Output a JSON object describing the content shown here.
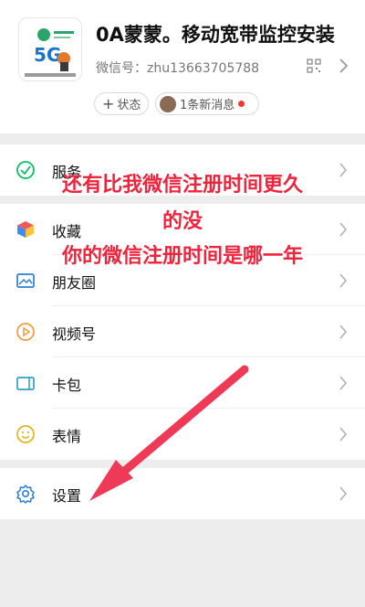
{
  "profile": {
    "nickname": "0A蒙蒙。移动宽带监控安装",
    "wechat_id": "微信号：zhu13663705788",
    "status_chip": "状态",
    "msg_chip": "1条新消息"
  },
  "menu": {
    "services": "服务",
    "favorites": "收藏",
    "moments": "朋友圈",
    "channels": "视频号",
    "cards": "卡包",
    "stickers": "表情",
    "settings": "设置"
  },
  "annotation": {
    "line1": "还有比我微信注册时间更久",
    "line2": "的没",
    "line3": "你的微信注册时间是哪一年"
  },
  "colors": {
    "overlay_text": "#f0233c",
    "arrow": "#ee3a57",
    "wechat_green": "#07c160",
    "page_bg": "#ededed"
  }
}
